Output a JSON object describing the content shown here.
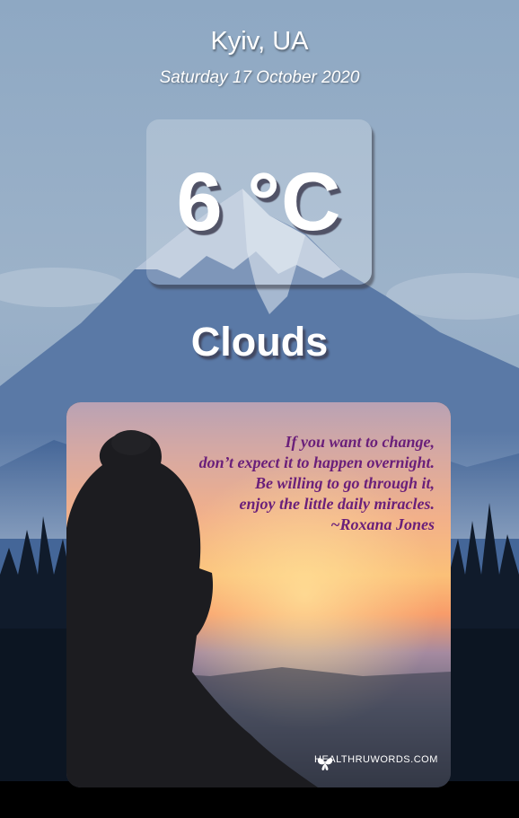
{
  "weather": {
    "location": "Kyiv, UA",
    "date": "Saturday 17 October 2020",
    "temperature": "6 °C",
    "condition": "Clouds"
  },
  "quote_card": {
    "lines": [
      "If you want to change,",
      "don’t expect it to happen overnight.",
      "Be willing to go through it,",
      "enjoy the little daily miracles."
    ],
    "author": "~Roxana Jones",
    "watermark_left": "HEALTHRUWORDS",
    "watermark_right": ".COM"
  },
  "colors": {
    "sky_top": "#8fa9c4",
    "mountain": "#4f6f9c",
    "forest": "#0e1a2a",
    "quote_text": "#6a1f7a",
    "sunset_orange": "#f7a26a"
  },
  "icons": {
    "watermark_logo": "butterfly-icon"
  }
}
